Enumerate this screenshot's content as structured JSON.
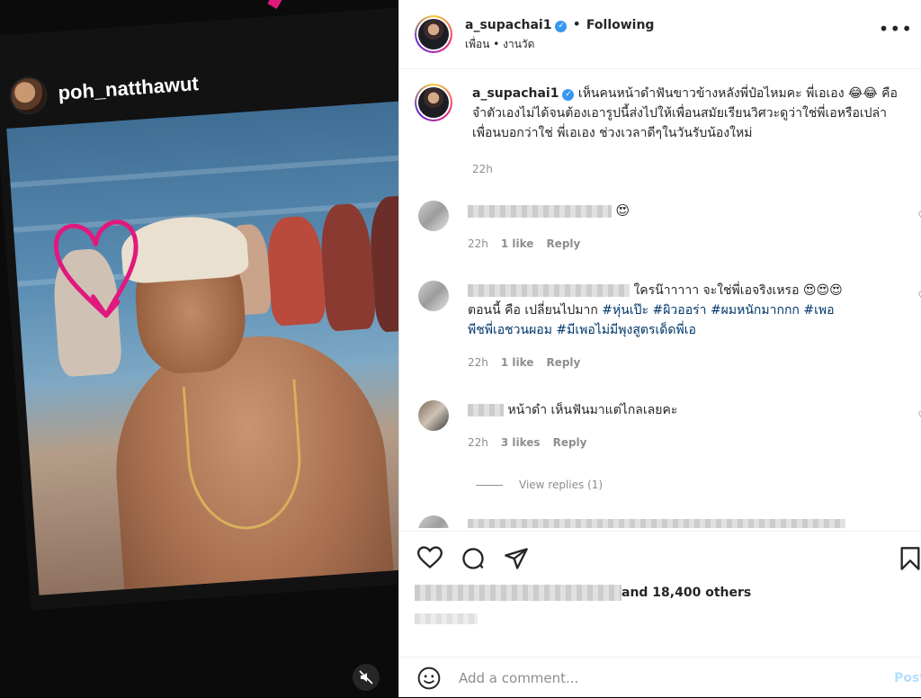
{
  "media": {
    "username": "poh_natthawut"
  },
  "post": {
    "author": "a_supachai1",
    "follow_status": "Following",
    "subline": "เพื่อน • งานวัด",
    "caption": "เห็นคนหน้าดำฟันขาวข้างหลังพี่ป๋อไหมคะ พี่เอเอง 😂😂 คือจำตัวเองไม่ได้จนต้องเอารูปนี้ส่งไปให้เพื่อนสมัยเรียนวิศวะดูว่าใช่พี่เอหรือเปล่า เพื่อนบอกว่าใช่ พี่เอเอง ช่วงเวลาดีๆในวันรับน้องใหม่",
    "caption_time": "22h"
  },
  "comments": [
    {
      "text": "😍",
      "time": "22h",
      "likes": "1 like",
      "reply": "Reply"
    },
    {
      "text_1": "ใครน๊าาาาา จะใช่พี่เอจริงเหรอ 😍😍😍",
      "text_2": "ตอนนี้ คือ เปลี่ยนไปมาก ",
      "tags": [
        "#หุ่นเป๊ะ",
        "#ผิวออร่า",
        "#ผมหนักมากกก",
        "#เพอ",
        "พีชพี่เอชวนผอม",
        "#มีเพอไม่มีพุงสูตรเด็ดพี่เอ"
      ],
      "time": "22h",
      "likes": "1 like",
      "reply": "Reply"
    },
    {
      "text": "หน้าดำ เห็นฟันมาแต่ไกลเลยคะ",
      "time": "22h",
      "likes": "3 likes",
      "reply": "Reply",
      "view_replies": "View replies (1)"
    }
  ],
  "likes": {
    "text": "and 18,400 others"
  },
  "comment_box": {
    "placeholder": "Add a comment...",
    "post_label": "Post"
  },
  "colors": {
    "link": "#00376b",
    "verified": "#3897f0",
    "meta": "#8e8e8e",
    "doodle": "#e0197d"
  }
}
